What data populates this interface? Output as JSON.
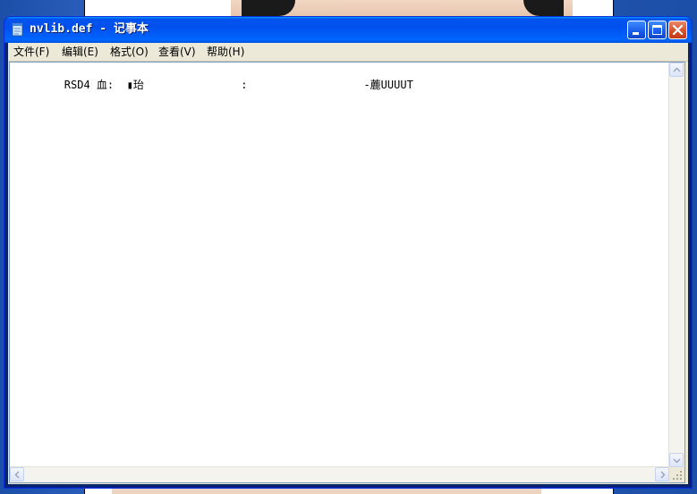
{
  "window": {
    "title": "nvlib.def - 记事本"
  },
  "menu": {
    "items": [
      {
        "label": "文件(F)"
      },
      {
        "label": "编辑(E)"
      },
      {
        "label": "格式(O)"
      },
      {
        "label": "查看(V)"
      },
      {
        "label": "帮助(H)"
      }
    ]
  },
  "document": {
    "line1": "RSD4 ⾎:  ▮珆               :                  -蔍UUUUT",
    "overbar_char": "‾"
  },
  "colors": {
    "titlebar": "#0053ee",
    "close_button": "#d7512b",
    "menu_bg": "#ece9d8"
  },
  "icons": [
    "notepad-icon",
    "minimize-icon",
    "maximize-icon",
    "close-icon",
    "scroll-up-icon",
    "scroll-down-icon",
    "scroll-left-icon",
    "scroll-right-icon",
    "size-grip-icon"
  ]
}
